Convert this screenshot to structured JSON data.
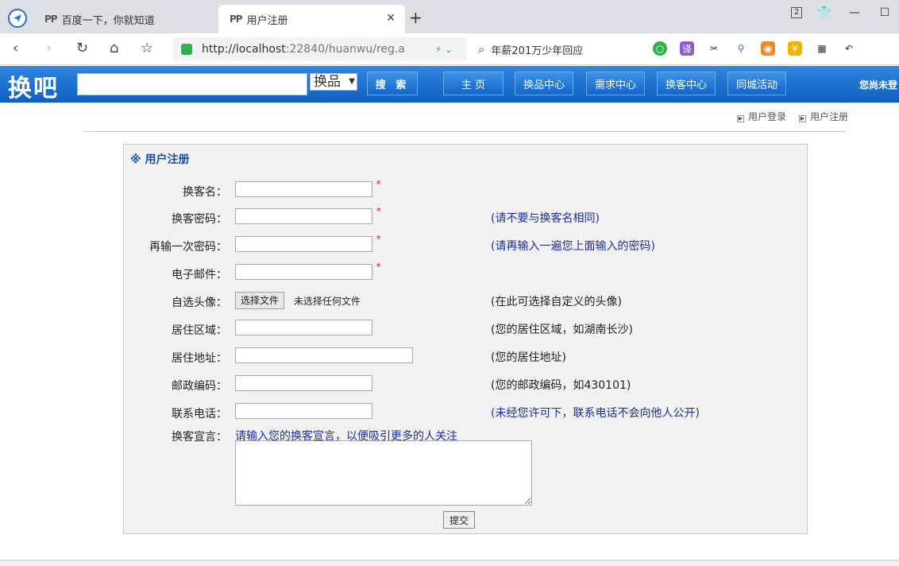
{
  "browser": {
    "tabs": [
      {
        "title": "百度一下，你就知道",
        "active": false
      },
      {
        "title": "用户注册",
        "active": true
      }
    ],
    "window_count": "2",
    "url_host": "http://localhost",
    "url_rest": ":22840/huanwu/reg.a",
    "search_text": "年薪201万少年回应"
  },
  "site": {
    "logo": "换吧",
    "category": "换品",
    "search_button": "搜 索",
    "nav": [
      "主 页",
      "换品中心",
      "需求中心",
      "换客中心",
      "同城活动"
    ],
    "user_status": "您尚未登",
    "user_links": [
      "用户登录",
      "用户注册"
    ]
  },
  "form": {
    "title": "※ 用户注册",
    "fields": [
      {
        "label": "换客名：",
        "required": true,
        "hint": ""
      },
      {
        "label": "换客密码：",
        "required": true,
        "hint": "(请不要与换客名相同)"
      },
      {
        "label": "再输一次密码：",
        "required": true,
        "hint": "(请再输入一遍您上面输入的密码)"
      },
      {
        "label": "电子邮件：",
        "required": true,
        "hint": ""
      },
      {
        "label": "自选头像：",
        "hint": "(在此可选择自定义的头像)"
      },
      {
        "label": "居住区域：",
        "hint": "(您的居住区域，如湖南长沙)"
      },
      {
        "label": "居住地址：",
        "hint": "(您的居住地址)"
      },
      {
        "label": "邮政编码：",
        "hint": "(您的邮政编码，如430101)"
      },
      {
        "label": "联系电话：",
        "hint": "(未经您许可下，联系电话不会向他人公开)"
      },
      {
        "label": "换客宣言：",
        "hint": "请输入您的换客宣言，以便吸引更多的人关注"
      }
    ],
    "required_mark": "*",
    "file_button": "选择文件",
    "file_none": "未选择任何文件",
    "submit": "提交"
  }
}
